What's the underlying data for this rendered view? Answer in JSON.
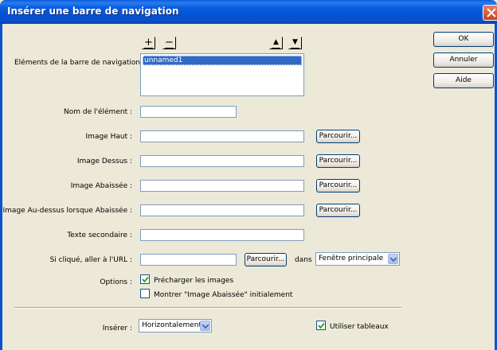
{
  "window": {
    "title": "Insérer une barre de navigation"
  },
  "toolbar": {
    "add_label": "+",
    "remove_label": "−",
    "up_label": "▲",
    "down_label": "▼"
  },
  "nav_elements": {
    "label": "Eléments de la barre de navigation :",
    "items": [
      "unnamed1"
    ],
    "selected_index": 0
  },
  "form": {
    "element_name_label": "Nom de l'élément :",
    "element_name_value": "",
    "image_up_label": "Image Haut :",
    "image_up_value": "",
    "image_over_label": "Image Dessus :",
    "image_over_value": "",
    "image_down_label": "Image Abaissée :",
    "image_down_value": "",
    "image_over_down_label": "Image Au-dessus lorsque Abaissée :",
    "image_over_down_value": "",
    "alt_text_label": "Texte secondaire :",
    "alt_text_value": "",
    "url_label": "Si cliqué, aller à l'URL :",
    "url_value": "",
    "browse_label": "Parcourir...",
    "in_label": "dans",
    "target_value": "Fenêtre principale"
  },
  "options": {
    "label": "Options :",
    "preload_label": "Précharger les images",
    "preload_checked": true,
    "show_down_label": "Montrer \"Image Abaissée\" initialement",
    "show_down_checked": false
  },
  "footer": {
    "insert_label": "Insérer :",
    "insert_value": "Horizontalement",
    "use_tables_label": "Utiliser tableaux",
    "use_tables_checked": true
  },
  "actions": {
    "ok_label": "OK",
    "cancel_label": "Annuler",
    "help_label": "Aide"
  },
  "colors": {
    "titlebar": "#0a5ddb",
    "dialog_bg": "#ece9d8",
    "selection": "#316ac5",
    "checkbox_check": "#21a121"
  }
}
